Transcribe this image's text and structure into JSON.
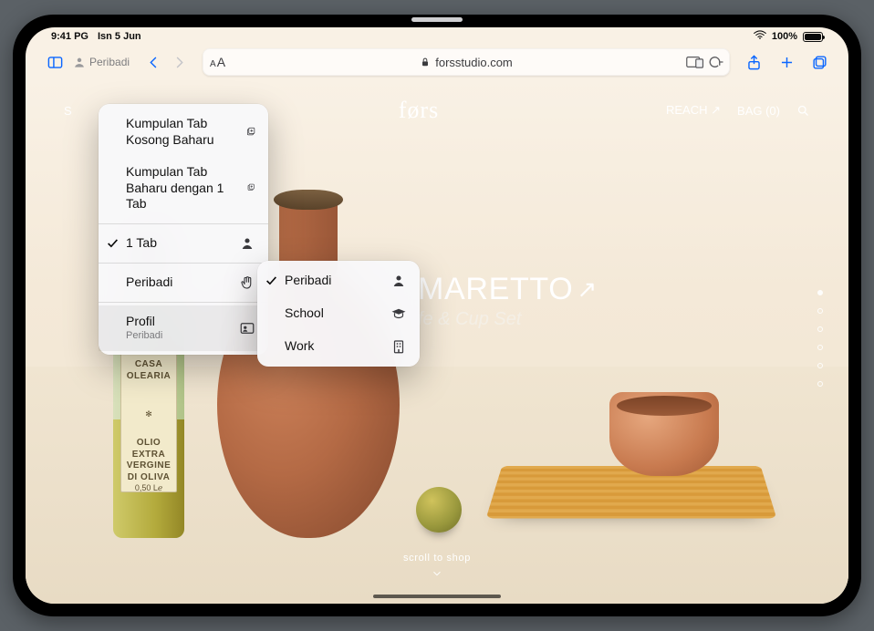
{
  "status": {
    "time": "9:41 PG",
    "date": "Isn 5 Jun",
    "battery_pct": "100%"
  },
  "toolbar": {
    "profile_label": "Peribadi",
    "url_host": "forsstudio.com"
  },
  "page": {
    "left_nav": "S",
    "brand": "førs",
    "reach": "REACH",
    "bag": "BAG (0)",
    "hero_title": "MARETTO",
    "hero_sub": "fe & Cup Set",
    "scroll_cue": "scroll to shop",
    "bottle": {
      "brand": "CASA OLEARIA",
      "l1": "OLIO EXTRA",
      "l2": "VERGINE",
      "l3": "DI OLIVA",
      "l4": "0,50 Lℯ"
    }
  },
  "menu_main": {
    "new_empty": "Kumpulan Tab Kosong Baharu",
    "new_with1": "Kumpulan Tab Baharu dengan 1 Tab",
    "one_tab": "1 Tab",
    "private": "Peribadi",
    "profile": "Profil",
    "profile_sub": "Peribadi"
  },
  "menu_profiles": {
    "items": [
      {
        "label": "Peribadi"
      },
      {
        "label": "School"
      },
      {
        "label": "Work"
      }
    ]
  }
}
